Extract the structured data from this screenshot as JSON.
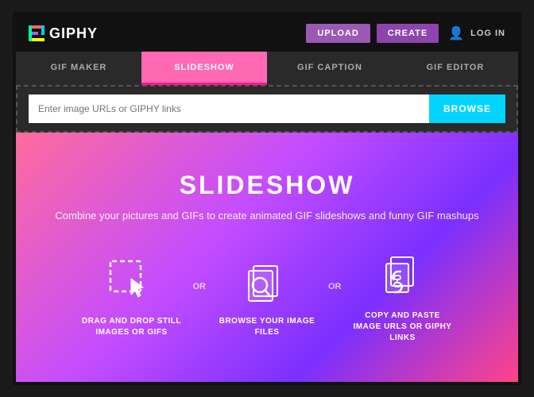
{
  "header": {
    "logo_text": "GIPHY",
    "btn_upload": "UPLOAD",
    "btn_create": "CREATE",
    "btn_login": "LOG IN"
  },
  "tabs": [
    {
      "id": "gif-maker",
      "label": "GIF MAKER",
      "active": false
    },
    {
      "id": "slideshow",
      "label": "SLIDESHOW",
      "active": true
    },
    {
      "id": "gif-caption",
      "label": "GIF CAPTION",
      "active": false
    },
    {
      "id": "gif-editor",
      "label": "GIF EDITOR",
      "active": false
    }
  ],
  "url_bar": {
    "placeholder": "Enter image URLs or GIPHY links",
    "browse_label": "BROWSE"
  },
  "main": {
    "title": "SLIDESHOW",
    "subtitle": "Combine your pictures and GIFs to create animated GIF\nslideshows and funny GIF mashups",
    "features": [
      {
        "id": "drag-drop",
        "label": "DRAG AND DROP STILL\nIMAGES OR GIFS"
      },
      {
        "id": "browse",
        "label": "BROWSE YOUR IMAGE FILES"
      },
      {
        "id": "copy-paste",
        "label": "COPY AND PASTE IMAGE\nURLS OR GIPHY LINKS"
      }
    ],
    "or_text": "OR"
  }
}
